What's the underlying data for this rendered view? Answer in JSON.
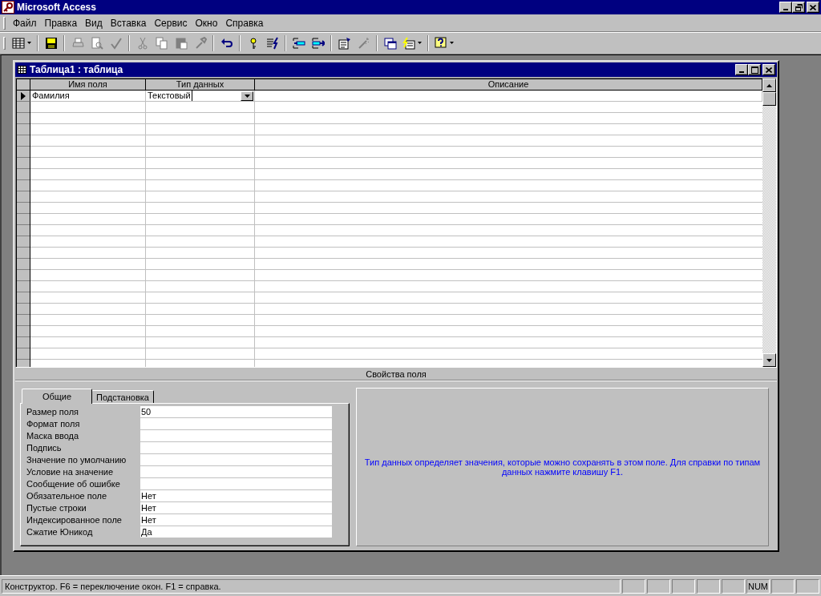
{
  "window": {
    "title": "Microsoft Access"
  },
  "menu": [
    "Файл",
    "Правка",
    "Вид",
    "Вставка",
    "Сервис",
    "Окно",
    "Справка"
  ],
  "toolbar": [
    {
      "kind": "view",
      "disabled": false
    },
    {
      "kind": "sep"
    },
    {
      "kind": "save",
      "disabled": false
    },
    {
      "kind": "sep"
    },
    {
      "kind": "print",
      "disabled": true
    },
    {
      "kind": "preview",
      "disabled": true
    },
    {
      "kind": "spelling",
      "disabled": true
    },
    {
      "kind": "sep"
    },
    {
      "kind": "cut",
      "disabled": true
    },
    {
      "kind": "copy",
      "disabled": true
    },
    {
      "kind": "paste",
      "disabled": true
    },
    {
      "kind": "painter",
      "disabled": true
    },
    {
      "kind": "sep"
    },
    {
      "kind": "undo",
      "disabled": false
    },
    {
      "kind": "sep"
    },
    {
      "kind": "key",
      "disabled": false
    },
    {
      "kind": "indexes",
      "disabled": false
    },
    {
      "kind": "sep"
    },
    {
      "kind": "insert_rows",
      "disabled": false
    },
    {
      "kind": "delete_rows",
      "disabled": false
    },
    {
      "kind": "sep"
    },
    {
      "kind": "properties",
      "disabled": false
    },
    {
      "kind": "build",
      "disabled": true
    },
    {
      "kind": "sep"
    },
    {
      "kind": "database",
      "disabled": false
    },
    {
      "kind": "new_object",
      "disabled": false
    },
    {
      "kind": "sep"
    },
    {
      "kind": "help",
      "disabled": false
    }
  ],
  "document": {
    "title": "Таблица1 : таблица",
    "columns": [
      "Имя поля",
      "Тип данных",
      "Описание"
    ],
    "rows": [
      {
        "name": "Фамилия",
        "type": "Текстовый",
        "current": true
      }
    ]
  },
  "properties": {
    "title": "Свойства поля",
    "tabs": [
      {
        "label": "Общие",
        "selected": true
      },
      {
        "label": "Подстановка",
        "selected": false
      }
    ],
    "fields": [
      {
        "label": "Размер поля",
        "value": "50"
      },
      {
        "label": "Формат поля"
      },
      {
        "label": "Маска ввода"
      },
      {
        "label": "Подпись"
      },
      {
        "label": "Значение по умолчанию"
      },
      {
        "label": "Условие на значение"
      },
      {
        "label": "Сообщение об ошибке"
      },
      {
        "label": "Обязательное поле",
        "value": "Нет"
      },
      {
        "label": "Пустые строки",
        "value": "Нет"
      },
      {
        "label": "Индексированное поле",
        "value": "Нет"
      },
      {
        "label": "Сжатие Юникод",
        "value": "Да"
      }
    ],
    "help": "Тип данных определяет значения, которые можно сохранять в этом поле.  Для справки по типам данных нажмите клавишу F1."
  },
  "status_bar": {
    "text": "Конструктор.  F6 = переключение окон.  F1 = справка.",
    "indicator": "NUM"
  }
}
